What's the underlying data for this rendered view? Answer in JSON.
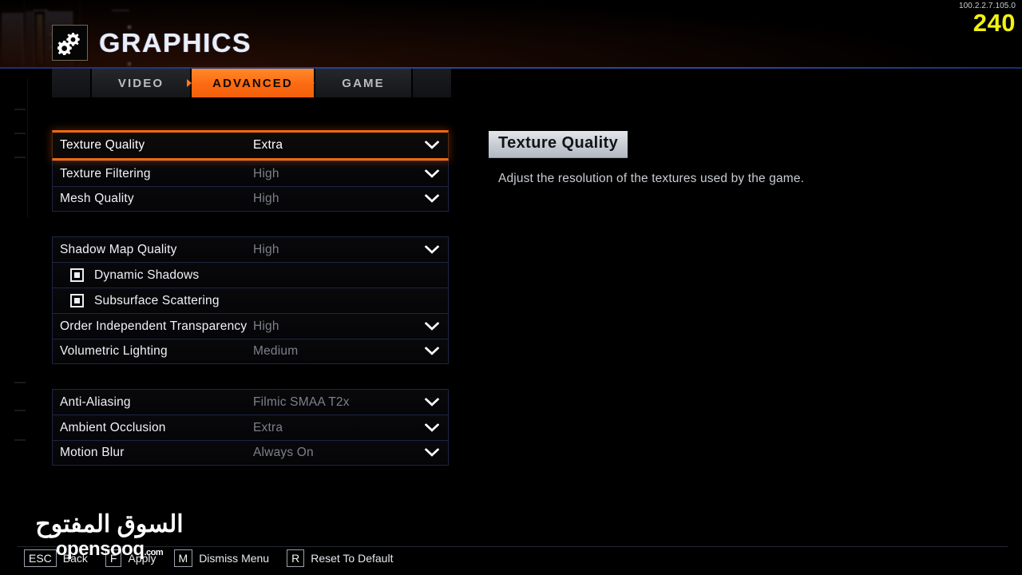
{
  "header": {
    "icon": "gears-icon",
    "title": "GRAPHICS"
  },
  "telemetry": {
    "ip": "100.2.2.7.105.0",
    "fps": "240",
    "fps_color": "#f1f113"
  },
  "tabs": [
    {
      "label": "VIDEO",
      "active": false
    },
    {
      "label": "ADVANCED",
      "active": true
    },
    {
      "label": "GAME",
      "active": false
    }
  ],
  "accent_color": "#f2680f",
  "settings_groups": [
    {
      "rows": [
        {
          "type": "dropdown",
          "label": "Texture Quality",
          "value": "Extra",
          "selected": true
        },
        {
          "type": "dropdown",
          "label": "Texture Filtering",
          "value": "High",
          "selected": false
        },
        {
          "type": "dropdown",
          "label": "Mesh Quality",
          "value": "High",
          "selected": false
        }
      ]
    },
    {
      "rows": [
        {
          "type": "dropdown",
          "label": "Shadow Map Quality",
          "value": "High",
          "selected": false
        },
        {
          "type": "checkbox",
          "label": "Dynamic Shadows",
          "checked": true
        },
        {
          "type": "checkbox",
          "label": "Subsurface Scattering",
          "checked": true
        },
        {
          "type": "dropdown",
          "label": "Order Independent Transparency",
          "value": "High",
          "selected": false
        },
        {
          "type": "dropdown",
          "label": "Volumetric Lighting",
          "value": "Medium",
          "selected": false
        }
      ]
    },
    {
      "rows": [
        {
          "type": "dropdown",
          "label": "Anti-Aliasing",
          "value": "Filmic SMAA T2x",
          "selected": false
        },
        {
          "type": "dropdown",
          "label": "Ambient Occlusion",
          "value": "Extra",
          "selected": false
        },
        {
          "type": "dropdown",
          "label": "Motion Blur",
          "value": "Always On",
          "selected": false
        }
      ]
    }
  ],
  "description": {
    "title": "Texture Quality",
    "body": "Adjust the resolution of the textures used by the game."
  },
  "hints": [
    {
      "key": "ESC",
      "label": "Back"
    },
    {
      "key": "F",
      "label": "Apply"
    },
    {
      "key": "M",
      "label": "Dismiss Menu"
    },
    {
      "key": "R",
      "label": "Reset To Default"
    }
  ],
  "watermark": {
    "arabic": "السوق المفتوح",
    "latin": "opensooq",
    "suffix": ".com"
  }
}
